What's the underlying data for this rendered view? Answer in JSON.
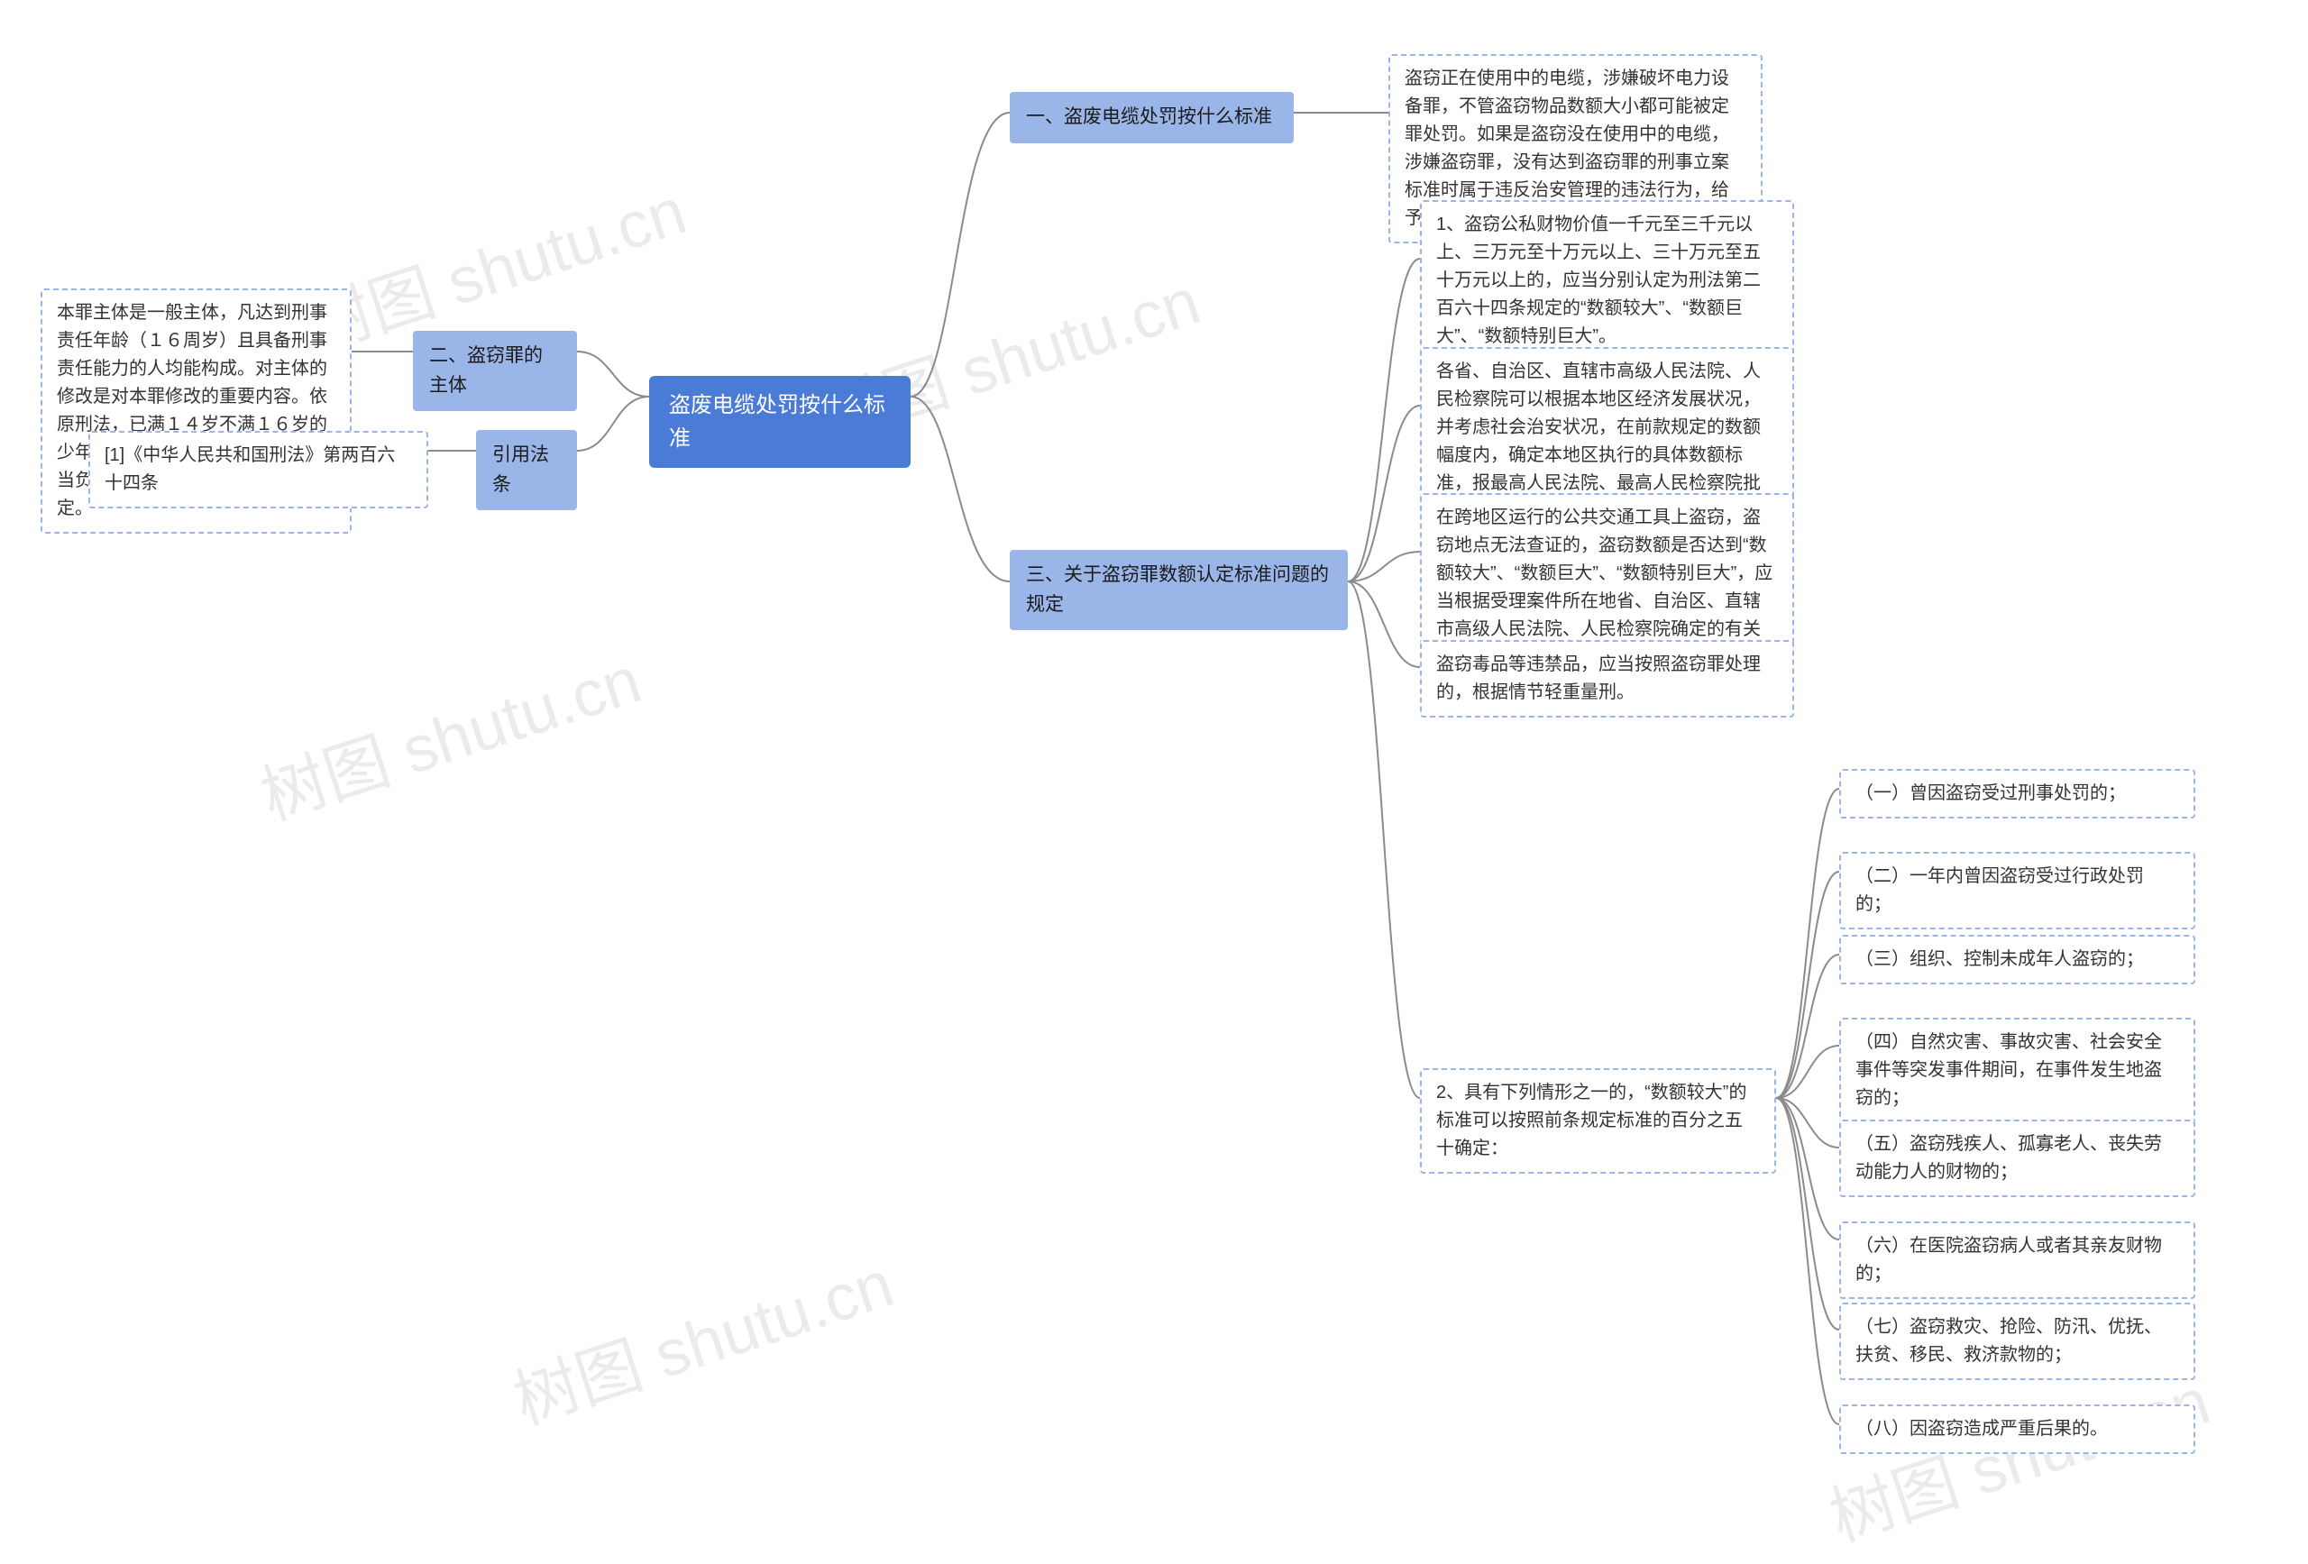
{
  "watermark": "树图 shutu.cn",
  "root": {
    "title": "盗废电缆处罚按什么标准"
  },
  "branches": {
    "b1": {
      "label": "一、盗废电缆处罚按什么标准",
      "leaf": "盗窃正在使用中的电缆，涉嫌破坏电力设备罪，不管盗窃物品数额大小都可能被定罪处罚。如果是盗窃没在使用中的电缆，涉嫌盗窃罪，没有达到盗窃罪的刑事立案标准时属于违反治安管理的违法行为，给予治安处罚。"
    },
    "b2": {
      "label": "二、盗窃罪的主体",
      "leaf": "本罪主体是一般主体，凡达到刑事责任年龄（１６周岁）且具备刑事责任能力的人均能构成。对主体的修改是对本罪修改的重要内容。依原刑法，已满１４岁不满１６岁的少年犯惯窃罪、重大盗窃罪的，应当负刑事责任。本法取消了此规定。"
    },
    "b3": {
      "label": "三、关于盗窃罪数额认定标准问题的规定",
      "leaves": {
        "l1": "1、盗窃公私财物价值一千元至三千元以上、三万元至十万元以上、三十万元至五十万元以上的，应当分别认定为刑法第二百六十四条规定的“数额较大”、“数额巨大”、“数额特别巨大”。",
        "l2": "各省、自治区、直辖市高级人民法院、人民检察院可以根据本地区经济发展状况，并考虑社会治安状况，在前款规定的数额幅度内，确定本地区执行的具体数额标准，报最高人民法院、最高人民检察院批准。",
        "l3": "在跨地区运行的公共交通工具上盗窃，盗窃地点无法查证的，盗窃数额是否达到“数额较大”、“数额巨大”、“数额特别巨大”，应当根据受理案件所在地省、自治区、直辖市高级人民法院、人民检察院确定的有关数额标准认定。",
        "l4": "盗窃毒品等违禁品，应当按照盗窃罪处理的，根据情节轻重量刑。",
        "l5": {
          "label": "2、具有下列情形之一的，“数额较大”的标准可以按照前条规定标准的百分之五十确定：",
          "items": {
            "i1": "（一）曾因盗窃受过刑事处罚的；",
            "i2": "（二）一年内曾因盗窃受过行政处罚的；",
            "i3": "（三）组织、控制未成年人盗窃的；",
            "i4": "（四）自然灾害、事故灾害、社会安全事件等突发事件期间，在事件发生地盗窃的；",
            "i5": "（五）盗窃残疾人、孤寡老人、丧失劳动能力人的财物的；",
            "i6": "（六）在医院盗窃病人或者其亲友财物的；",
            "i7": "（七）盗窃救灾、抢险、防汛、优抚、扶贫、移民、救济款物的；",
            "i8": "（八）因盗窃造成严重后果的。"
          }
        }
      }
    },
    "b4": {
      "label": "引用法条",
      "leaf": "[1]《中华人民共和国刑法》第两百六十四条"
    }
  }
}
